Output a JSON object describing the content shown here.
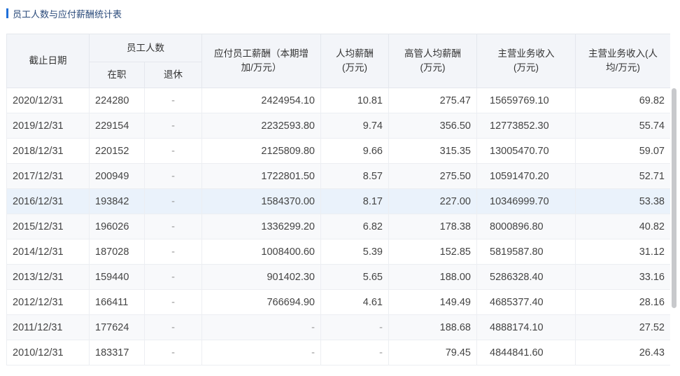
{
  "title": "员工人数与应付薪酬统计表",
  "headers": {
    "date": "截止日期",
    "employees": "员工人数",
    "active": "在职",
    "retired": "退休",
    "payable": "应付员工薪酬（本期增加/万元）",
    "avg_salary": "人均薪酬(万元)",
    "exec_avg": "高管人均薪酬(万元)",
    "revenue": "主营业务收入(万元)",
    "revenue_per": "主营业务收入(人均/万元)"
  },
  "rows": [
    [
      "2020/12/31",
      "224280",
      "-",
      "2424954.10",
      "10.81",
      "275.47",
      "15659769.10",
      "69.82"
    ],
    [
      "2019/12/31",
      "229154",
      "-",
      "2232593.80",
      "9.74",
      "356.50",
      "12773852.30",
      "55.74"
    ],
    [
      "2018/12/31",
      "220152",
      "-",
      "2125809.80",
      "9.66",
      "315.35",
      "13005470.70",
      "59.07"
    ],
    [
      "2017/12/31",
      "200949",
      "-",
      "1722801.50",
      "8.57",
      "275.50",
      "10591470.20",
      "52.71"
    ],
    [
      "2016/12/31",
      "193842",
      "-",
      "1584370.00",
      "8.17",
      "227.00",
      "10346999.70",
      "53.38"
    ],
    [
      "2015/12/31",
      "196026",
      "-",
      "1336299.20",
      "6.82",
      "178.38",
      "8000896.80",
      "40.82"
    ],
    [
      "2014/12/31",
      "187028",
      "-",
      "1008400.60",
      "5.39",
      "152.85",
      "5819587.80",
      "31.12"
    ],
    [
      "2013/12/31",
      "159440",
      "-",
      "901402.30",
      "5.65",
      "188.00",
      "5286328.40",
      "33.16"
    ],
    [
      "2012/12/31",
      "166411",
      "-",
      "766694.90",
      "4.61",
      "149.49",
      "4685377.40",
      "28.16"
    ],
    [
      "2011/12/31",
      "177624",
      "-",
      "-",
      "-",
      "188.68",
      "4888174.10",
      "27.52"
    ],
    [
      "2010/12/31",
      "183317",
      "-",
      "-",
      "-",
      "79.45",
      "4844841.60",
      "26.43"
    ]
  ],
  "highlighted_row": 4,
  "colors": {
    "accent": "#1e6fd9",
    "header_bg": "#f3f5f9",
    "highlight": "#eaf2fb"
  }
}
